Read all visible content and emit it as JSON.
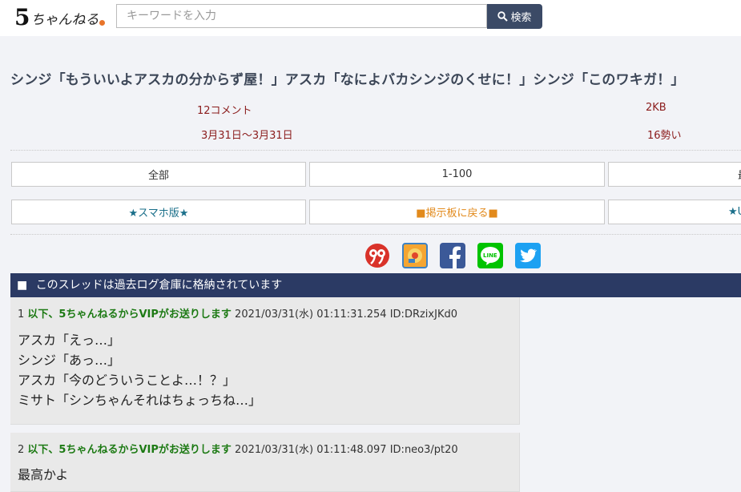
{
  "header": {
    "logo_five": "5",
    "logo_name": "ちゃんねる",
    "search_placeholder": "キーワードを入力",
    "search_button": "検索"
  },
  "thread": {
    "title": "シンジ「もういいよアスカの分からず屋！」アスカ「なによバカシンジのくせに！」シンジ「このワキガ！」",
    "comments": "12コメント",
    "size": "2KB",
    "date_range": "3月31日～3月31日",
    "momentum": "16勢い"
  },
  "nav": {
    "all": "全部",
    "range": "1-100",
    "latest_partial": "最",
    "smartphone": "★スマホ版★",
    "back_to_board": "■掲示板に戻る■",
    "third_row_partial": "★U"
  },
  "share": {
    "icons": [
      "99-icon",
      "orange-app-icon",
      "facebook-icon",
      "line-icon",
      "twitter-icon"
    ],
    "line_text": "LINE"
  },
  "notice": {
    "bullet": "■",
    "text": "このスレッドは過去ログ倉庫に格納されています"
  },
  "posts": [
    {
      "number": "1",
      "author": "以下、5ちゃんねるからVIPがお送りします",
      "date": "2021/03/31(水) 01:11:31.254 ID:DRzixJKd0",
      "lines": [
        "アスカ「えっ…」",
        "シンジ「あっ…」",
        "アスカ「今のどういうことよ…！？」",
        "ミサト「シンちゃんそれはちょっちね…」"
      ]
    },
    {
      "number": "2",
      "author": "以下、5ちゃんねるからVIPがお送りします",
      "date": "2021/03/31(水) 01:11:48.097 ID:neo3/pt20",
      "lines": [
        "最高かよ"
      ]
    }
  ],
  "colors": {
    "header_bg": "#ffffff",
    "page_bg": "#f2f3f7",
    "search_button": "#3b4a66",
    "notice_bg": "#2b3a64",
    "meta_text": "#8b1c1c",
    "author": "#1d7a14",
    "nav_link_teal": "#1a6f8a",
    "nav_link_orange": "#e28a1c"
  }
}
